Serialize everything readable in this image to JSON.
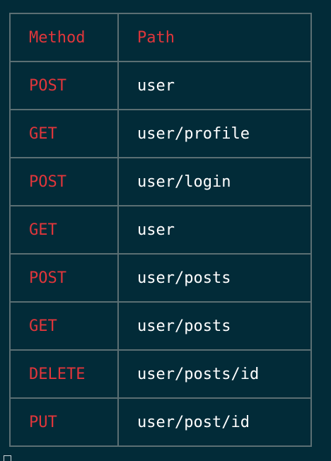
{
  "table": {
    "headers": {
      "method": "Method",
      "path": "Path"
    },
    "rows": [
      {
        "method": "POST",
        "path": "user"
      },
      {
        "method": "GET",
        "path": "user/profile"
      },
      {
        "method": "POST",
        "path": "user/login"
      },
      {
        "method": "GET",
        "path": "user"
      },
      {
        "method": "POST",
        "path": "user/posts"
      },
      {
        "method": "GET",
        "path": "user/posts"
      },
      {
        "method": "DELETE",
        "path": "user/posts/id"
      },
      {
        "method": "PUT",
        "path": "user/post/id"
      }
    ]
  },
  "colors": {
    "background": "#022b38",
    "method_text": "#e0363b",
    "path_text": "#ffffff",
    "border": "#5b6f73"
  }
}
